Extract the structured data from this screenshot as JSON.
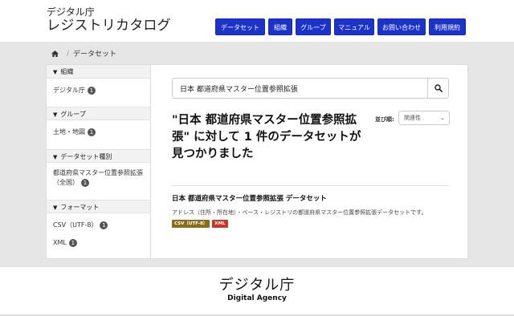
{
  "brand": {
    "org": "デジタル庁",
    "name": "レジストリカタログ"
  },
  "nav": {
    "items": [
      {
        "label": "データセット",
        "width": 62
      },
      {
        "label": "組織",
        "width": 30
      },
      {
        "label": "グループ",
        "width": 44
      },
      {
        "label": "マニュアル",
        "width": 50
      },
      {
        "label": "お問い合わせ",
        "width": 60
      },
      {
        "label": "利用規約",
        "width": 46
      }
    ]
  },
  "breadcrumb": {
    "current": "データセット"
  },
  "facets": {
    "org": {
      "title": "組織",
      "items": [
        {
          "label": "デジタル庁",
          "count": "1"
        }
      ]
    },
    "group": {
      "title": "グループ",
      "items": [
        {
          "label": "土地・地図",
          "count": "1"
        }
      ]
    },
    "type": {
      "title": "データセット種別",
      "items": [
        {
          "label": "都道府県マスター位置参照拡張",
          "label2": "（全国）",
          "count": "1"
        }
      ]
    },
    "format": {
      "title": "フォーマット",
      "items": [
        {
          "label": "CSV（UTF-8）",
          "count": "1"
        },
        {
          "label": "XML",
          "count": "1"
        }
      ]
    }
  },
  "search": {
    "value": "日本 都道府県マスター位置参照拡張"
  },
  "results": {
    "line1": "\"日本 都道府県マスター位置参照拡",
    "line2": "張\" に対して 1 件のデータセットが",
    "line3": "見つかりました",
    "sort_label": "並び順:",
    "sort_value": "関連性"
  },
  "dataset": {
    "title": "日本 都道府県マスター位置参照拡張 データセット",
    "description": "アドレス（住所・所在地）・ベース・レジストリの都道府県マスター位置参照拡張データセットです。",
    "tags": [
      {
        "label": "CSV（UTF-8）",
        "color": "#8a6d1c"
      },
      {
        "label": "XML",
        "color": "#c0392b"
      }
    ]
  },
  "footer": {
    "jp": "デジタル庁",
    "en": "Digital Agency"
  },
  "colors": {
    "nav": "#1d33c8",
    "band": "#e6e6e6"
  }
}
